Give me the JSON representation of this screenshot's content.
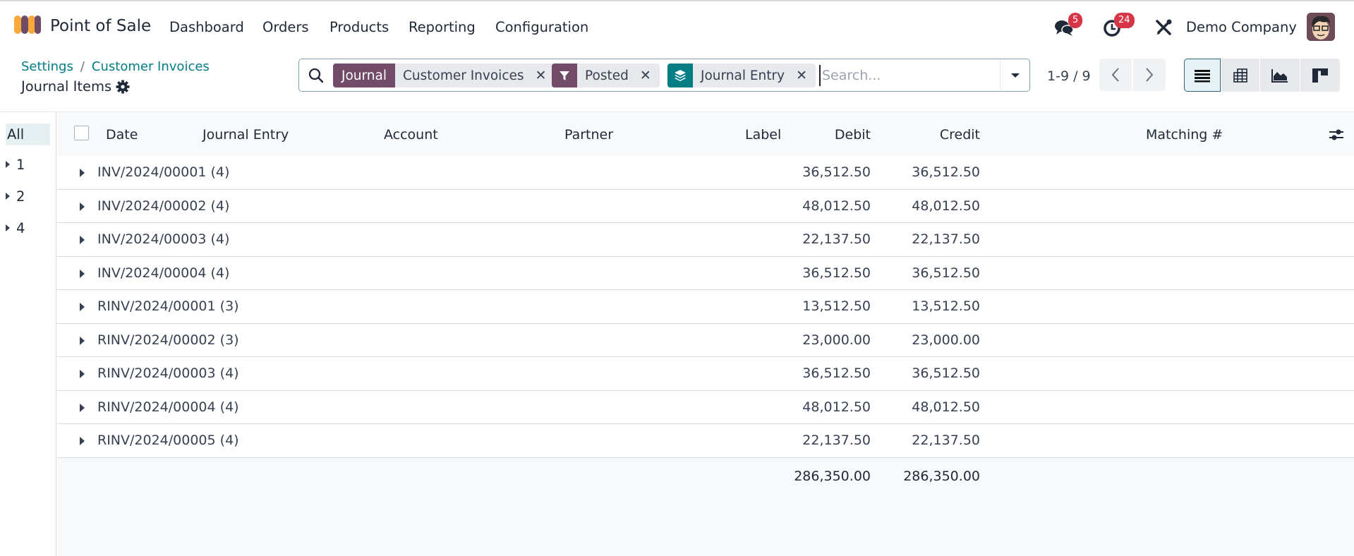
{
  "navbar": {
    "app_name": "Point of Sale",
    "menu": [
      "Dashboard",
      "Orders",
      "Products",
      "Reporting",
      "Configuration"
    ],
    "messages_count": "5",
    "activities_count": "24",
    "company": "Demo Company",
    "icons": [
      "pos-logo-icon",
      "chat-icon",
      "clock-icon",
      "tools-icon",
      "user-avatar"
    ]
  },
  "breadcrumb": {
    "items": [
      "Settings",
      "Customer Invoices"
    ],
    "separator": "/",
    "current": "Journal Items"
  },
  "search": {
    "facets": [
      {
        "tag": "Journal",
        "value": "Customer Invoices",
        "tag_color": "#714b67",
        "icon": null
      },
      {
        "tag": "",
        "value": "Posted",
        "tag_color": "#714b67",
        "icon": "filter-icon"
      },
      {
        "tag": "",
        "value": "Journal Entry",
        "tag_color": "#017e84",
        "icon": "layers-icon"
      }
    ],
    "placeholder": "Search...",
    "value": ""
  },
  "pager": {
    "value": "1-9 / 9"
  },
  "views": [
    "list",
    "pivot",
    "graph",
    "kanban"
  ],
  "active_view": "list",
  "side_panel": {
    "items": [
      {
        "label": "All",
        "active": true,
        "expandable": false
      },
      {
        "label": "1",
        "active": false,
        "expandable": true
      },
      {
        "label": "2",
        "active": false,
        "expandable": true
      },
      {
        "label": "4",
        "active": false,
        "expandable": true
      }
    ]
  },
  "table": {
    "columns": [
      "Date",
      "Journal Entry",
      "Account",
      "Partner",
      "Label",
      "Debit",
      "Credit",
      "Matching #"
    ],
    "groups": [
      {
        "name": "INV/2024/00001 (4)",
        "debit": "36,512.50",
        "credit": "36,512.50"
      },
      {
        "name": "INV/2024/00002 (4)",
        "debit": "48,012.50",
        "credit": "48,012.50"
      },
      {
        "name": "INV/2024/00003 (4)",
        "debit": "22,137.50",
        "credit": "22,137.50"
      },
      {
        "name": "INV/2024/00004 (4)",
        "debit": "36,512.50",
        "credit": "36,512.50"
      },
      {
        "name": "RINV/2024/00001 (3)",
        "debit": "13,512.50",
        "credit": "13,512.50"
      },
      {
        "name": "RINV/2024/00002 (3)",
        "debit": "23,000.00",
        "credit": "23,000.00"
      },
      {
        "name": "RINV/2024/00003 (4)",
        "debit": "36,512.50",
        "credit": "36,512.50"
      },
      {
        "name": "RINV/2024/00004 (4)",
        "debit": "48,012.50",
        "credit": "48,012.50"
      },
      {
        "name": "RINV/2024/00005 (4)",
        "debit": "22,137.50",
        "credit": "22,137.50"
      }
    ],
    "totals": {
      "debit": "286,350.00",
      "credit": "286,350.00"
    }
  },
  "colors": {
    "brand": "#714b67",
    "teal": "#017e84",
    "badge": "#d63548",
    "link": "#017e84"
  }
}
